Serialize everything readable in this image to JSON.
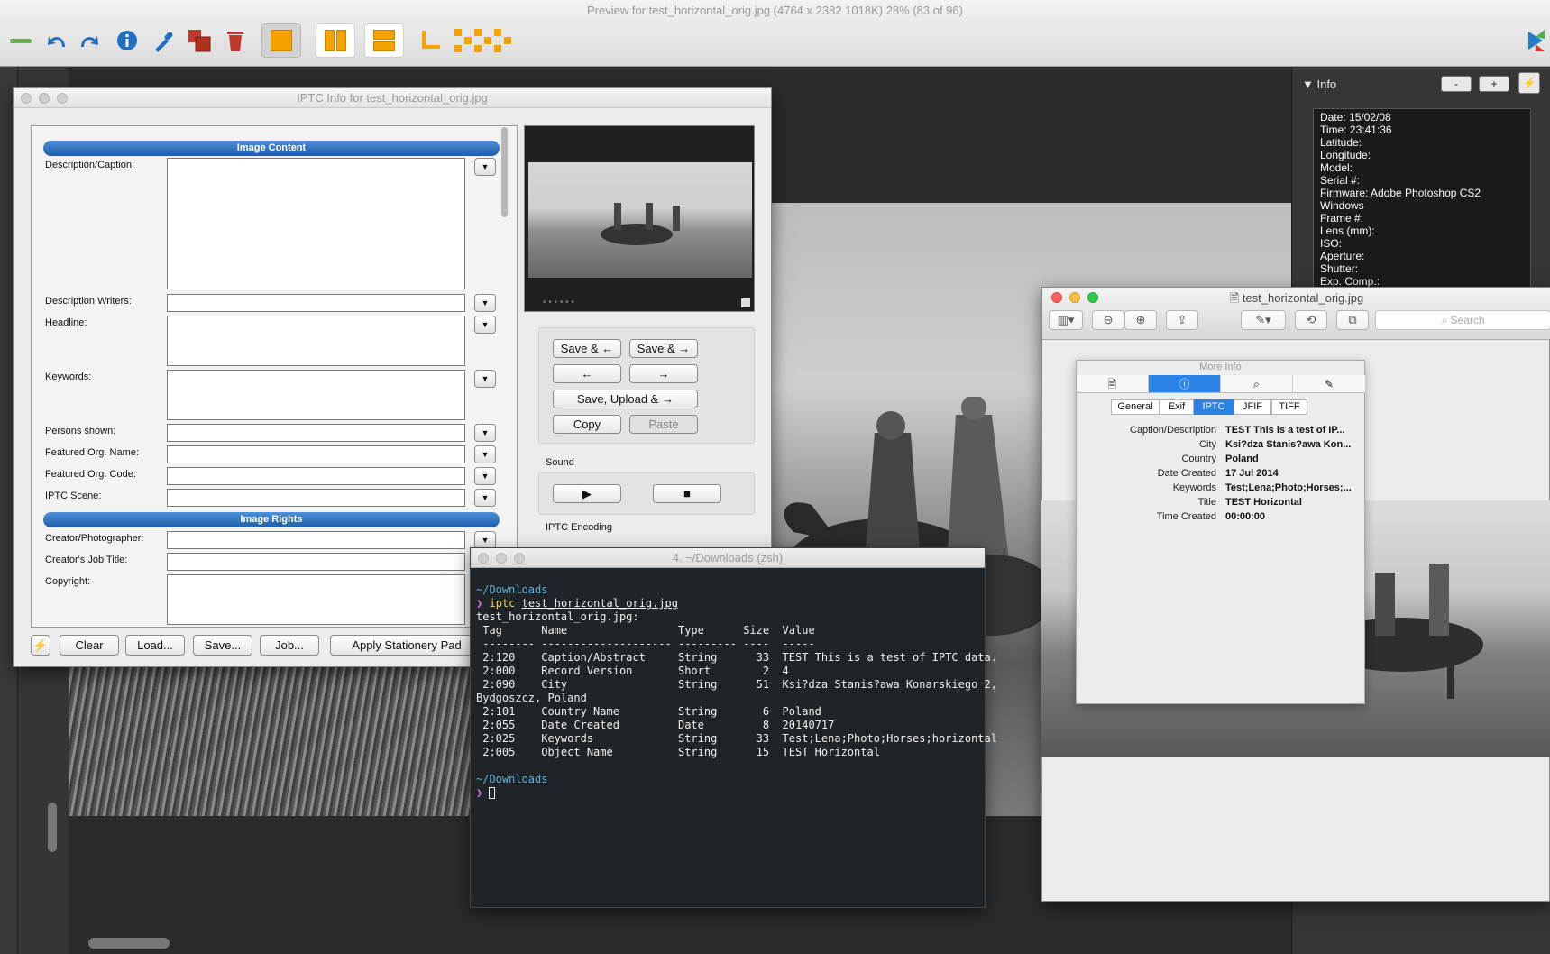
{
  "app": {
    "title": "Preview for test_horizontal_orig.jpg (4764 x 2382 1018K) 28% (83 of 96)"
  },
  "toolbar": {
    "icons": [
      "minus-icon",
      "undo-icon",
      "redo-icon",
      "info-icon",
      "eyedropper-icon",
      "copy-icon",
      "trash-icon",
      "single-view-icon",
      "two-column-view-icon",
      "two-row-view-icon",
      "crop-corner-icon",
      "grid-view-icon",
      "app-logo-icon"
    ]
  },
  "info_panel": {
    "title": "Info",
    "minus_label": "-",
    "plus_label": "+",
    "lines": [
      "Date: 15/02/08",
      "Time: 23:41:36",
      "Latitude:",
      "Longitude:",
      "Model:",
      "Serial #:",
      "Firmware: Adobe Photoshop CS2",
      "Windows",
      "Frame #:",
      "Lens (mm):",
      "ISO:",
      "Aperture:",
      "Shutter:",
      "Exp. Comp.:"
    ]
  },
  "iptc_window": {
    "title": "IPTC Info for test_horizontal_orig.jpg",
    "image_content_header": "Image Content",
    "image_rights_header": "Image Rights",
    "fields": {
      "description_caption": "Description/Caption:",
      "description_writers": "Description Writers:",
      "headline": "Headline:",
      "keywords": "Keywords:",
      "persons_shown": "Persons shown:",
      "featured_org_name": "Featured Org. Name:",
      "featured_org_code": "Featured Org. Code:",
      "iptc_scene": "IPTC Scene:",
      "creator_photographer": "Creator/Photographer:",
      "creators_job_title": "Creator's Job Title:",
      "copyright": "Copyright:"
    },
    "dropdown_glyph": "▼",
    "buttons": {
      "save_prev": "Save & ←",
      "save_next": "Save & →",
      "prev": "←",
      "next": "→",
      "save_upload_next": "Save, Upload & →",
      "copy": "Copy",
      "paste": "Paste",
      "play": "▶",
      "stop": "■",
      "lightning": "⚡",
      "clear": "Clear",
      "load": "Load...",
      "save": "Save...",
      "job": "Job...",
      "apply_stationery": "Apply Stationery Pad"
    },
    "sound_label": "Sound",
    "encoding_label": "IPTC Encoding"
  },
  "preview_window": {
    "title": "test_horizontal_orig.jpg",
    "search_placeholder": "Search"
  },
  "more_info": {
    "title": "More Info",
    "tabs": [
      "General",
      "Exif",
      "IPTC",
      "JFIF",
      "TIFF"
    ],
    "selected_tab": "IPTC",
    "rows": [
      {
        "key": "Caption/Description",
        "value": "TEST This is a test of IP..."
      },
      {
        "key": "City",
        "value": "Ksi?dza Stanis?awa Kon..."
      },
      {
        "key": "Country",
        "value": "Poland"
      },
      {
        "key": "Date Created",
        "value": "17 Jul 2014"
      },
      {
        "key": "Keywords",
        "value": "Test;Lena;Photo;Horses;..."
      },
      {
        "key": "Title",
        "value": "TEST Horizontal"
      },
      {
        "key": "Time Created",
        "value": "00:00:00"
      }
    ]
  },
  "terminal": {
    "title": "4. ~/Downloads (zsh)",
    "cwd": "~/Downloads",
    "prompt": "❯",
    "command": "iptc",
    "argument": "test_horizontal_orig.jpg",
    "file_header": "test_horizontal_orig.jpg:",
    "table_header": " Tag      Name                 Type      Size  Value",
    "table_rule": " -------- -------------------- --------- ----  -----",
    "rows": [
      " 2:120    Caption/Abstract     String      33  TEST This is a test of IPTC data.",
      " 2:000    Record Version       Short        2  4",
      " 2:090    City                 String      51  Ksi?dza Stanis?awa Konarskiego 2,",
      "Bydgoszcz, Poland",
      " 2:101    Country Name         String       6  Poland",
      " 2:055    Date Created         Date         8  20140717",
      " 2:025    Keywords             String      33  Test;Lena;Photo;Horses;horizontal",
      " 2:005    Object Name          String      15  TEST Horizontal"
    ]
  }
}
